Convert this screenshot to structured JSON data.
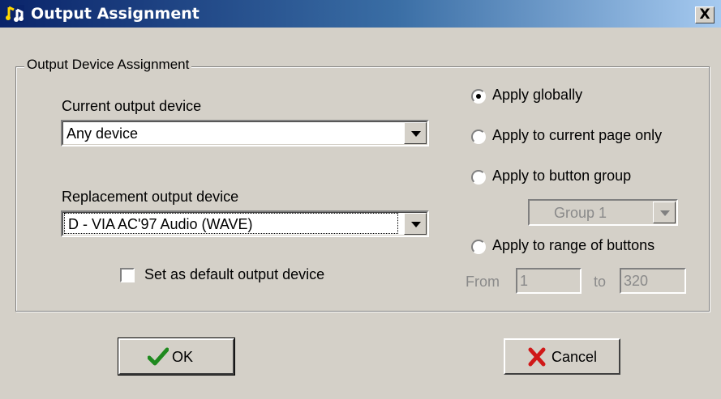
{
  "window": {
    "title": "Output Assignment",
    "close_label": "X"
  },
  "group": {
    "legend": "Output Device Assignment",
    "current_label": "Current output device",
    "current_value": "Any device",
    "replacement_label": "Replacement output device",
    "replacement_value": "D - VIA AC'97 Audio (WAVE)",
    "default_checkbox_label": "Set as default output device",
    "default_checked": false
  },
  "scope": {
    "options": [
      {
        "label": "Apply globally",
        "checked": true
      },
      {
        "label": "Apply to current page only",
        "checked": false
      },
      {
        "label": "Apply to button group",
        "checked": false
      },
      {
        "label": "Apply to range of buttons",
        "checked": false
      }
    ],
    "group_select_value": "Group 1",
    "from_label": "From",
    "from_value": "1",
    "to_label": "to",
    "to_value": "320"
  },
  "buttons": {
    "ok_label": "OK",
    "cancel_label": "Cancel"
  },
  "icons": {
    "app": "music-notes-icon",
    "ok": "checkmark-icon",
    "cancel": "red-x-icon"
  }
}
